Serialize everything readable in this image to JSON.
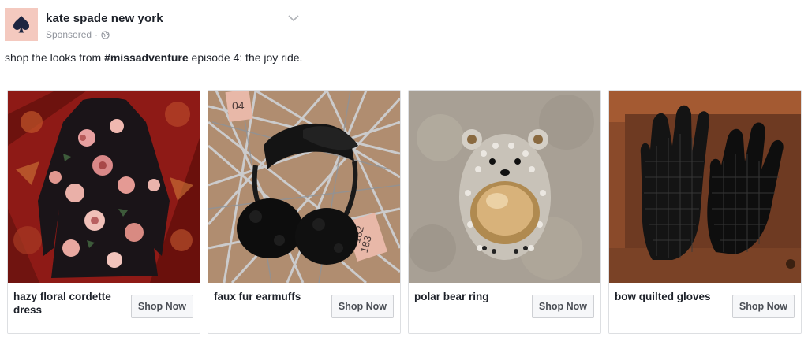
{
  "post": {
    "page_name": "kate spade new york",
    "sponsored_label": "Sponsored",
    "separator": "·",
    "caption_prefix": "shop the looks from ",
    "caption_hashtag": "#missadventure",
    "caption_suffix": " episode 4:  the joy ride."
  },
  "cards": [
    {
      "title": "hazy floral cordette dress",
      "cta": "Shop Now"
    },
    {
      "title": "faux fur earmuffs",
      "cta": "Shop Now"
    },
    {
      "title": "polar bear ring",
      "cta": "Shop Now"
    },
    {
      "title": "bow quilted gloves",
      "cta": "Shop Now"
    }
  ],
  "image_tags": {
    "tag_a": "04",
    "tag_b": "182",
    "tag_c": "183"
  },
  "colors": {
    "logo_bg": "#f4c9bf",
    "logo_spade": "#1c2541",
    "meta_text": "#90949c",
    "card_border": "#dddfe2",
    "button_bg": "#f6f7f9"
  },
  "icons": {
    "logo": "spade-icon",
    "audience": "globe-icon",
    "menu": "chevron-down-icon"
  }
}
